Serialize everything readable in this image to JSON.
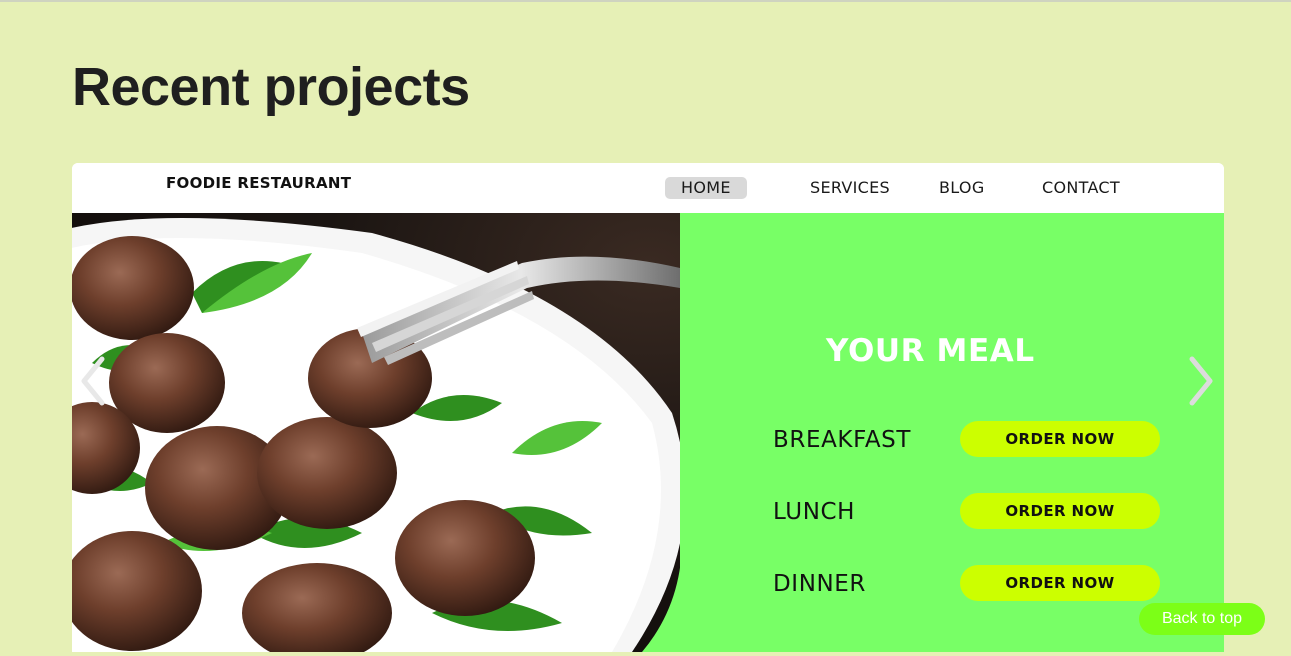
{
  "section": {
    "title": "Recent projects"
  },
  "project": {
    "brand": "FOODIE RESTAURANT",
    "nav": [
      {
        "label": "HOME",
        "active": true
      },
      {
        "label": "SERVICES",
        "active": false
      },
      {
        "label": "BLOG",
        "active": false
      },
      {
        "label": "CONTACT",
        "active": false
      }
    ],
    "hero_title": "YOUR MEAL",
    "meals": [
      {
        "label": "BREAKFAST",
        "button": "ORDER NOW"
      },
      {
        "label": "LUNCH",
        "button": "ORDER NOW"
      },
      {
        "label": "DINNER",
        "button": "ORDER NOW"
      }
    ],
    "image_subject": "meatballs with arugula on a white plate, fork",
    "colors": {
      "panel": "#78ff66",
      "order_button": "#ccff00",
      "nav_active": "#d9d9d9"
    }
  },
  "carousel": {
    "prev_icon": "chevron-left-icon",
    "next_icon": "chevron-right-icon"
  },
  "back_to_top": {
    "label": "Back to top",
    "color": "#7cff17"
  },
  "colors": {
    "page_background": "#e6f0b6"
  }
}
